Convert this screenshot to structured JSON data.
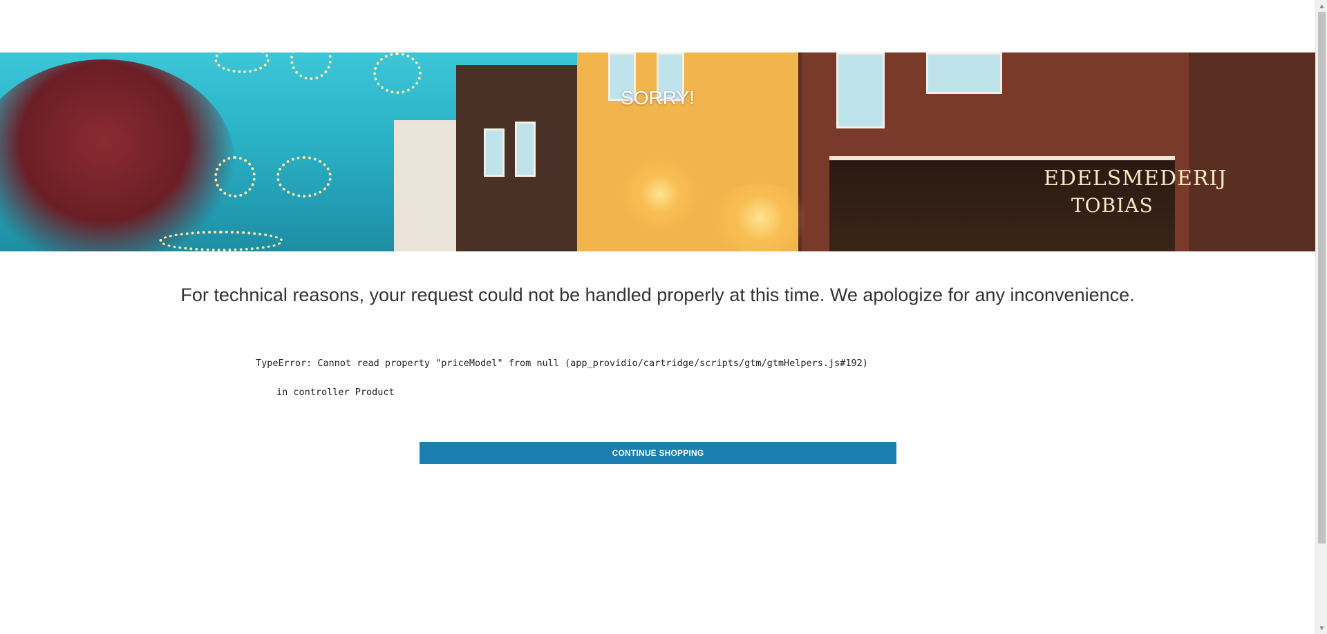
{
  "hero": {
    "title": "SORRY!",
    "image_alt": "street-scene-banner"
  },
  "message": {
    "text": "For technical reasons, your request could not be handled properly at this time. We apologize for any inconvenience."
  },
  "error": {
    "line1": "TypeError: Cannot read property \"priceModel\" from null (app_providio/cartridge/scripts/gtm/gtmHelpers.js#192)",
    "line2": "in controller Product"
  },
  "cta": {
    "label": "CONTINUE SHOPPING"
  },
  "scrollbar": {
    "up_icon": "chevron-up-icon",
    "down_icon": "chevron-down-icon"
  },
  "colors": {
    "cta_background": "#1a7fb0",
    "text": "#333333"
  }
}
